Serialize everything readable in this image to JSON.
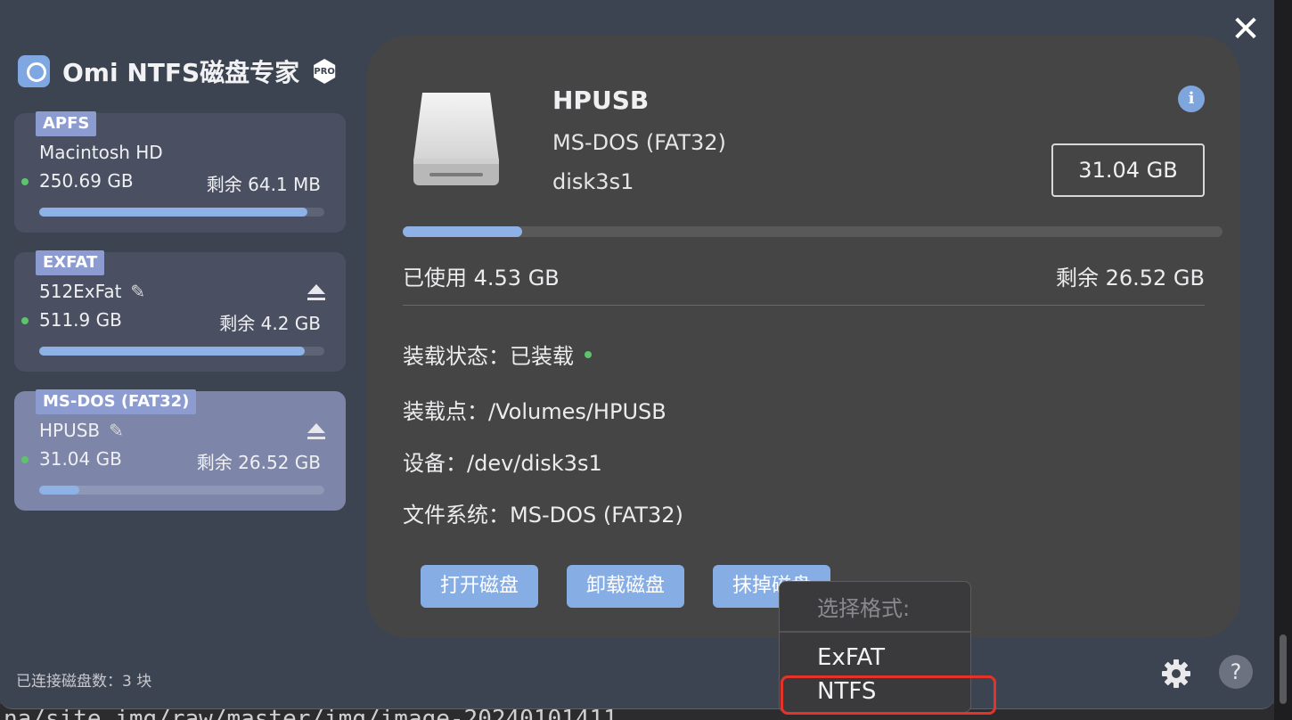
{
  "app": {
    "title": "Omi NTFS磁盘专家",
    "badge": "PRO"
  },
  "sidebar": {
    "disks": [
      {
        "fs": "APFS",
        "name": "Macintosh HD",
        "size": "250.69 GB",
        "free": "剩余 64.1 MB",
        "usage": 0.94,
        "editable": false,
        "ejectable": false
      },
      {
        "fs": "EXFAT",
        "name": "512ExFat",
        "size": "511.9 GB",
        "free": "剩余 4.2 GB",
        "usage": 0.93,
        "editable": true,
        "ejectable": true
      },
      {
        "fs": "MS-DOS (FAT32)",
        "name": "HPUSB",
        "size": "31.04 GB",
        "free": "剩余 26.52 GB",
        "usage": 0.14,
        "editable": true,
        "ejectable": true,
        "selected": true
      }
    ],
    "footer": "已连接磁盘数：3 块"
  },
  "detail": {
    "name": "HPUSB",
    "fs": "MS-DOS (FAT32)",
    "device_id": "disk3s1",
    "capacity": "31.04 GB",
    "usage": 0.146,
    "used": "已使用 4.53 GB",
    "remaining": "剩余 26.52 GB",
    "mount_status": "装载状态：已装载",
    "mount_point": "装载点：/Volumes/HPUSB",
    "device": "设备：/dev/disk3s1",
    "filesystem": "文件系统：MS-DOS (FAT32)",
    "actions": {
      "open": "打开磁盘",
      "unmount": "卸载磁盘",
      "erase": "抹掉磁盘"
    }
  },
  "format_menu": {
    "header": "选择格式:",
    "options": [
      "ExFAT",
      "NTFS"
    ]
  },
  "background_text": "na/site img/raw/master/img/image-20240101411..."
}
